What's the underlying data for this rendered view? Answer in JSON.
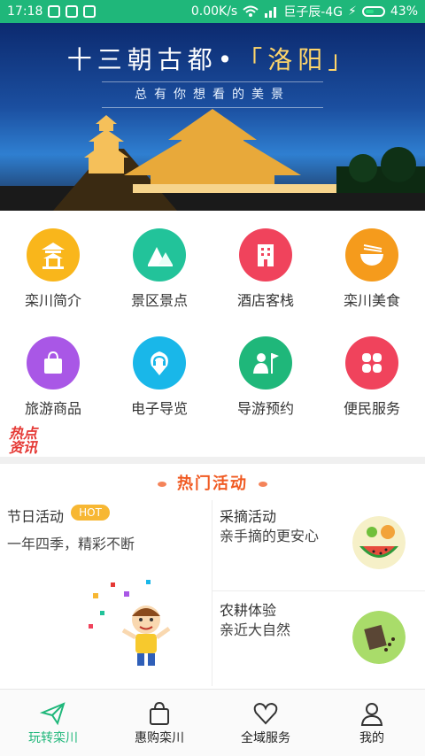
{
  "status_bar": {
    "time": "17:18",
    "net_speed": "0.00K/s",
    "carrier": "巨子辰-4G",
    "battery": "43%"
  },
  "banner": {
    "title_main": "十三朝古都•",
    "title_accent": "「洛阳」",
    "subtitle": "总有你想看的美景"
  },
  "grid": [
    {
      "label": "栾川简介",
      "icon": "pavilion-icon",
      "color": "#f9b61b"
    },
    {
      "label": "景区景点",
      "icon": "mountain-icon",
      "color": "#22c39a"
    },
    {
      "label": "酒店客栈",
      "icon": "building-icon",
      "color": "#f0435c"
    },
    {
      "label": "栾川美食",
      "icon": "bowl-icon",
      "color": "#f59b1c"
    },
    {
      "label": "旅游商品",
      "icon": "shopping-bag-icon",
      "color": "#a957e6"
    },
    {
      "label": "电子导览",
      "icon": "headphone-pin-icon",
      "color": "#19b7e9"
    },
    {
      "label": "导游预约",
      "icon": "guide-flag-icon",
      "color": "#1fb77a"
    },
    {
      "label": "便民服务",
      "icon": "service-icon",
      "color": "#f0435c"
    }
  ],
  "hot_info_badge": "热点资讯",
  "section_title": "热门活动",
  "activities": {
    "left": {
      "title": "节日活动",
      "tag": "HOT",
      "subtitle": "一年四季，精彩不断"
    },
    "top_right": {
      "title": "采摘活动",
      "subtitle": "亲手摘的更安心"
    },
    "bottom_right": {
      "title": "农耕体验",
      "subtitle": "亲近大自然"
    }
  },
  "tabbar": [
    {
      "label": "玩转栾川",
      "icon": "paper-plane-icon",
      "active": true
    },
    {
      "label": "惠购栾川",
      "icon": "shopping-bag-icon",
      "active": false
    },
    {
      "label": "全域服务",
      "icon": "heart-icon",
      "active": false
    },
    {
      "label": "我的",
      "icon": "user-icon",
      "active": false
    }
  ]
}
